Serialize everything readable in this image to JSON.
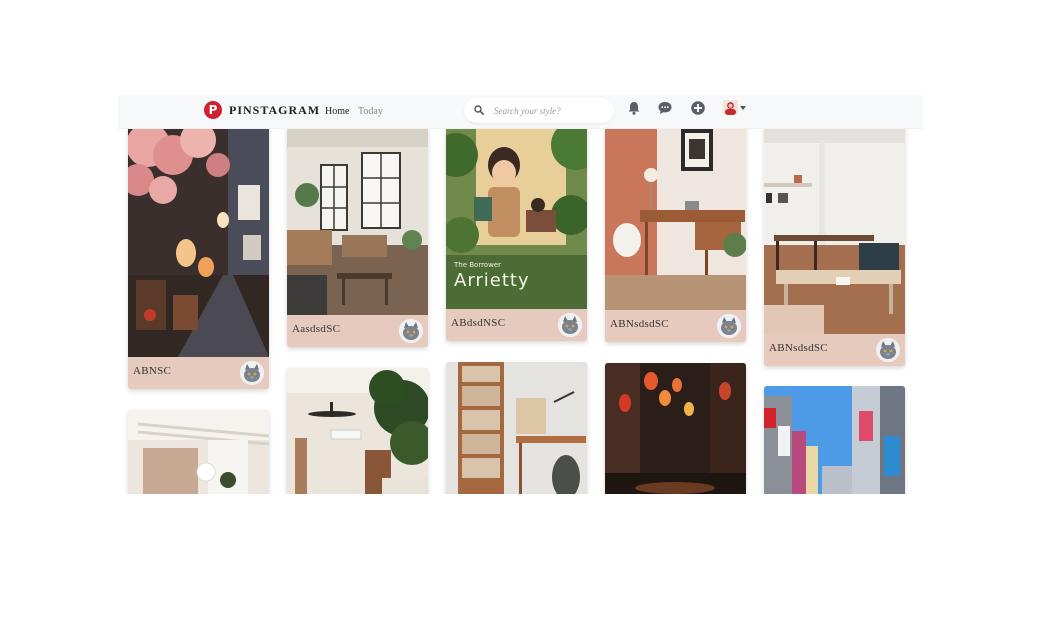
{
  "brand": {
    "logo_letter": "P",
    "name": "PINSTAGRAM"
  },
  "nav": {
    "home": "Home",
    "today": "Today"
  },
  "search": {
    "placeholder": "Search your style?"
  },
  "icons": {
    "notifications": "bell-icon",
    "messages": "chat-bubble-icon",
    "create": "plus-circle-icon",
    "account": "user-avatar",
    "menu": "caret-down-icon"
  },
  "colors": {
    "brand": "#d1202e",
    "card_footer": "#e6cabd",
    "navbar_bg": "#f7f8f9"
  },
  "pins": [
    {
      "title": "ABNSC",
      "image": "night-alley-with-cherry-blossoms-and-lanterns"
    },
    {
      "title": "AasdsdSC",
      "image": "loft-living-room-with-tall-windows"
    },
    {
      "title": "ABdsdNSC",
      "image": "anime-poster",
      "poster_text": "Arrietty",
      "poster_subtitle": "The Borrower"
    },
    {
      "title": "ABNsdsdSC",
      "image": "desk-with-terracotta-wall"
    },
    {
      "title": "ABNsdsdSC",
      "image": "white-studio-office"
    },
    {
      "title": "",
      "image": "bright-interior-with-curtains"
    },
    {
      "title": "",
      "image": "room-with-ceiling-fan-and-plant"
    },
    {
      "title": "",
      "image": "wooden-bookshelf-and-desk"
    },
    {
      "title": "",
      "image": "street-with-red-lanterns"
    },
    {
      "title": "",
      "image": "city-street-with-billboards"
    }
  ]
}
